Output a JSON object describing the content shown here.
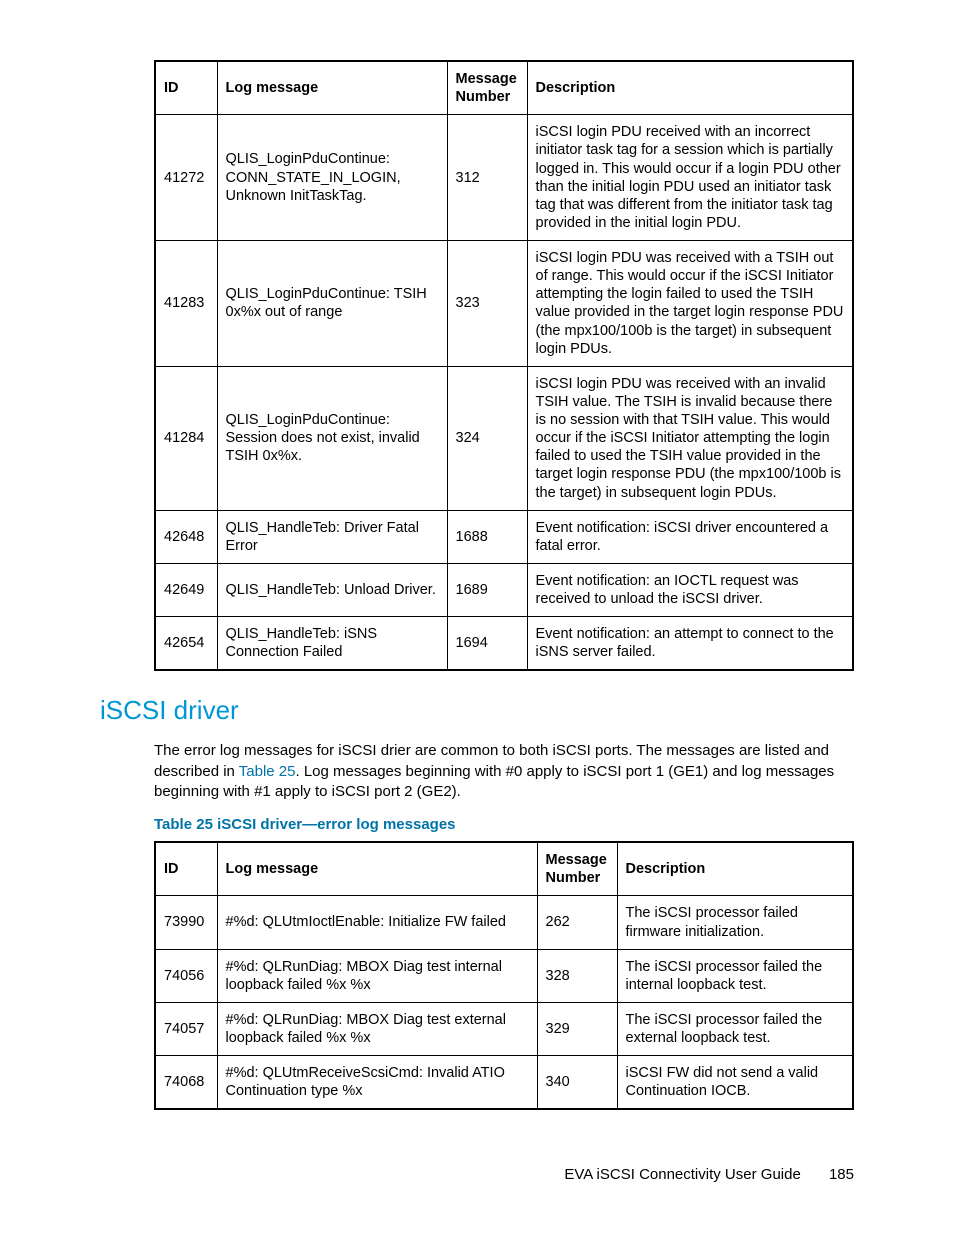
{
  "table1": {
    "headers": [
      "ID",
      "Log message",
      "Message Number",
      "Description"
    ],
    "rows": [
      {
        "id": "41272",
        "msg": "QLIS_LoginPduContinue: CONN_STATE_IN_LOGIN, Unknown InitTaskTag.",
        "num": "312",
        "desc": "iSCSI login PDU received with an incorrect initiator task tag for a session which is partially logged in. This would occur if a login PDU other than the initial login PDU used an initiator task tag that was different from the initiator task tag provided in the initial login PDU."
      },
      {
        "id": "41283",
        "msg": "QLIS_LoginPduContinue: TSIH 0x%x out of range",
        "num": "323",
        "desc": "iSCSI login PDU was received with a TSIH out of range. This would occur if the iSCSI Initiator attempting the login failed to used the TSIH value provided in the target login response PDU (the mpx100/100b is the target) in subsequent login PDUs."
      },
      {
        "id": "41284",
        "msg": "QLIS_LoginPduContinue: Session does not exist, invalid TSIH 0x%x.",
        "num": "324",
        "desc": "iSCSI login PDU was received with an invalid TSIH value. The TSIH is invalid because there is no session with that TSIH value. This would occur if the iSCSI Initiator attempting the login failed to used the TSIH value provided in the target login response PDU (the mpx100/100b is the target) in subsequent login PDUs."
      },
      {
        "id": "42648",
        "msg": "QLIS_HandleTeb: Driver Fatal Error",
        "num": "1688",
        "desc": "Event notification: iSCSI driver encountered a fatal error."
      },
      {
        "id": "42649",
        "msg": "QLIS_HandleTeb: Unload Driver.",
        "num": "1689",
        "desc": "Event notification: an IOCTL request was received to unload the iSCSI driver."
      },
      {
        "id": "42654",
        "msg": "QLIS_HandleTeb: iSNS Connection Failed",
        "num": "1694",
        "desc": "Event notification: an attempt to connect to the iSNS server failed."
      }
    ]
  },
  "section": {
    "heading": "iSCSI driver",
    "para_before_link": "The error log messages for iSCSI drier are common to both iSCSI ports. The messages are listed and described in ",
    "link": "Table 25",
    "para_after_link": ". Log messages beginning with #0 apply to iSCSI port 1 (GE1) and log messages beginning with #1 apply to iSCSI port 2 (GE2).",
    "table_caption": "Table 25 iSCSI driver—error log messages"
  },
  "table2": {
    "headers": [
      "ID",
      "Log message",
      "Message Number",
      "Description"
    ],
    "rows": [
      {
        "id": "73990",
        "msg": "#%d: QLUtmIoctlEnable: Initialize FW failed",
        "num": "262",
        "desc": "The iSCSI processor failed firmware initialization."
      },
      {
        "id": "74056",
        "msg": "#%d: QLRunDiag: MBOX Diag test internal loopback failed %x %x",
        "num": "328",
        "desc": "The iSCSI processor failed the internal loopback test."
      },
      {
        "id": "74057",
        "msg": "#%d: QLRunDiag: MBOX Diag test external loopback failed %x %x",
        "num": "329",
        "desc": "The iSCSI processor failed the external loopback test."
      },
      {
        "id": "74068",
        "msg": "#%d: QLUtmReceiveScsiCmd: Invalid ATIO Continuation type %x",
        "num": "340",
        "desc": "iSCSI FW did not send a valid Continuation IOCB."
      }
    ]
  },
  "footer": {
    "title": "EVA iSCSI Connectivity User Guide",
    "page": "185"
  }
}
